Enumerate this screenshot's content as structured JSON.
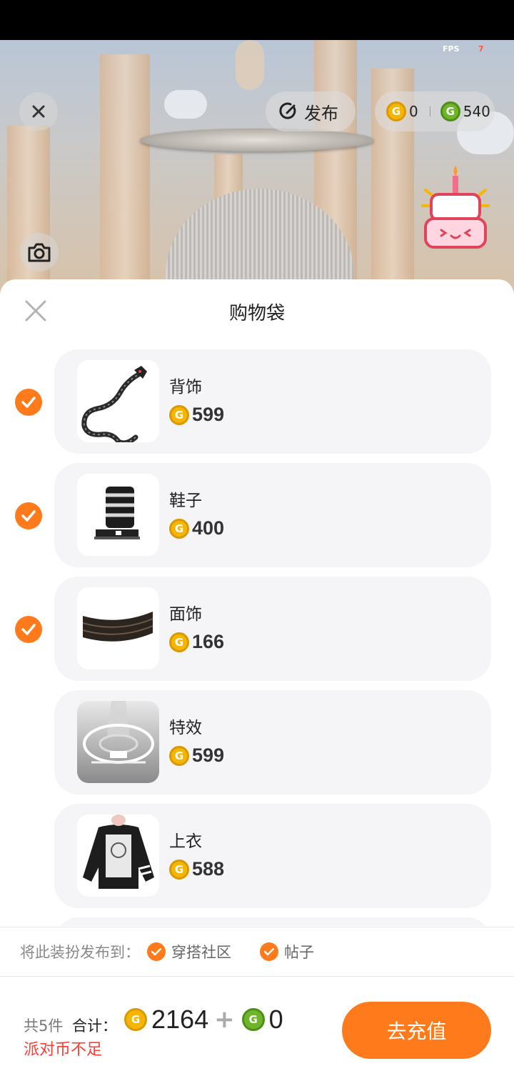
{
  "status": {
    "fps_label": "FPS",
    "fps_value": "7"
  },
  "topbar": {
    "publish_label": "发布",
    "coin_gold_amount": "0",
    "coin_green_amount": "540",
    "coin_symbol": "G"
  },
  "sheet": {
    "title": "购物袋",
    "items": [
      {
        "name": "背饰",
        "price": "599",
        "checked": true
      },
      {
        "name": "鞋子",
        "price": "400",
        "checked": true
      },
      {
        "name": "面饰",
        "price": "166",
        "checked": true
      },
      {
        "name": "特效",
        "price": "599",
        "checked": false
      },
      {
        "name": "上衣",
        "price": "588",
        "checked": false
      }
    ]
  },
  "publish_to": {
    "label": "将此装扮发布到：",
    "option1": "穿搭社区",
    "option2": "帖子"
  },
  "footer": {
    "count": "共5件",
    "sum_label": "合计：",
    "gold_total": "2164",
    "plus": "+",
    "green_total": "0",
    "warning": "派对币不足",
    "recharge_label": "去充值"
  },
  "colors": {
    "accent": "#ff7a1a",
    "warning": "#ff3b30",
    "gold": "#f5b500",
    "green": "#6fb52c"
  }
}
